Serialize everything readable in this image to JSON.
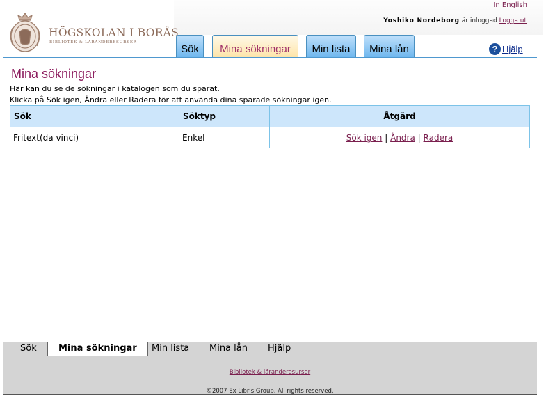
{
  "header": {
    "logo": {
      "title": "HÖGSKOLAN I BORÅS",
      "subtitle": "BIBLIOTEK & LÄRANDERESURSER"
    },
    "lang_link": "In English",
    "user": {
      "name": "Yoshiko Nordeborg",
      "status": "är inloggad",
      "logout": "Logga ut"
    },
    "tabs": [
      {
        "label": "Sök"
      },
      {
        "label": "Mina sökningar",
        "active": true
      },
      {
        "label": "Min lista"
      },
      {
        "label": "Mina lån"
      }
    ],
    "help": {
      "icon": "help-icon",
      "label": "Hjälp"
    }
  },
  "main": {
    "title": "Mina sökningar",
    "intro": [
      "Här kan du se de sökningar i katalogen som du sparat.",
      "Klicka på Sök igen, Ändra eller Radera för att använda dina sparade sökningar igen."
    ],
    "table": {
      "headers": [
        "Sök",
        "Söktyp",
        "Åtgärd"
      ],
      "rows": [
        {
          "search": "Fritext(da vinci)",
          "type": "Enkel",
          "actions": [
            "Sök igen",
            "Ändra",
            "Radera"
          ],
          "separator": "|"
        }
      ]
    }
  },
  "footer": {
    "tabs": [
      {
        "label": "Sök"
      },
      {
        "label": "Mina sökningar",
        "active": true
      },
      {
        "label": "Min lista"
      },
      {
        "label": "Mina lån"
      },
      {
        "label": "Hjälp"
      }
    ],
    "link": "Bibliotek & läranderesurser",
    "copyright": "©2007 Ex Libris Group. All rights reserved."
  },
  "colors": {
    "accent": "#8b1a5c",
    "tab_blue": "#6fb7ee",
    "tab_active": "#fde4a8",
    "table_header": "#cde6fb",
    "rule": "#4f98cf"
  }
}
